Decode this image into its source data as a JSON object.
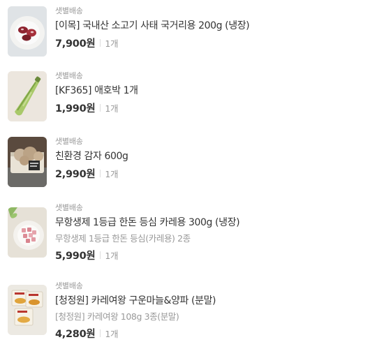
{
  "items": [
    {
      "delivery": "샛별배송",
      "name": "[이목] 국내산 소고기 사태 국거리용 200g (냉장)",
      "option": "",
      "price": "7,900원",
      "qty": "1개",
      "image_icon": "beef-image-icon"
    },
    {
      "delivery": "샛별배송",
      "name": "[KF365] 애호박 1개",
      "option": "",
      "price": "1,990원",
      "qty": "1개",
      "image_icon": "zucchini-image-icon"
    },
    {
      "delivery": "샛별배송",
      "name": "친환경 감자 600g",
      "option": "",
      "price": "2,990원",
      "qty": "1개",
      "image_icon": "potato-image-icon"
    },
    {
      "delivery": "샛별배송",
      "name": "무항생제 1등급 한돈 등심 카레용 300g (냉장)",
      "option": "무항생제 1등급 한돈 등심(카레용) 2종",
      "price": "5,990원",
      "qty": "1개",
      "image_icon": "pork-image-icon"
    },
    {
      "delivery": "샛별배송",
      "name": "[청정원] 카레여왕 구운마늘&양파 (분말)",
      "option": "[청정원] 카레여왕 108g 3종(분말)",
      "price": "4,280원",
      "qty": "1개",
      "image_icon": "curry-image-icon"
    }
  ]
}
